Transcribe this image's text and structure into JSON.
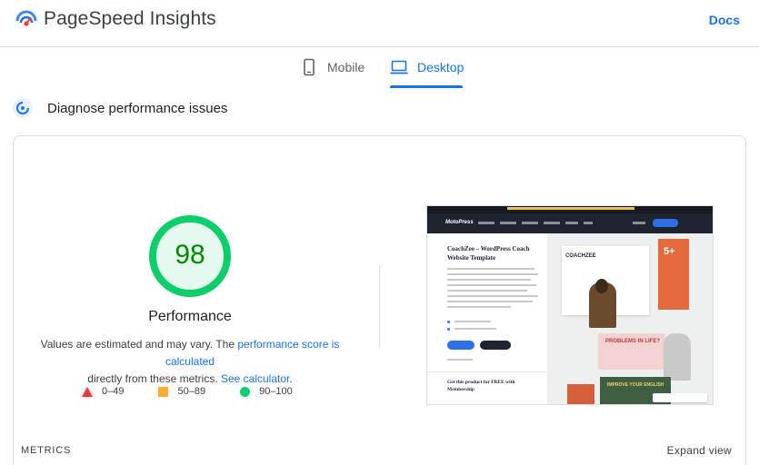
{
  "header": {
    "app_title": "PageSpeed Insights",
    "logo_icon": "pagespeed-logo-icon",
    "docs_label": "Docs"
  },
  "tabs": [
    {
      "label": "Mobile",
      "icon": "smartphone-icon",
      "selected": false
    },
    {
      "label": "Desktop",
      "icon": "laptop-icon",
      "selected": true
    }
  ],
  "diagnose": {
    "icon": "diagnose-icon",
    "title": "Diagnose performance issues"
  },
  "performance": {
    "score": "98",
    "label": "Performance",
    "note_prefix": "Values are estimated and may vary. The ",
    "note_link1": "performance score is calculated",
    "note_middle": " directly from these metrics. ",
    "note_link2": "See calculator",
    "note_suffix": "."
  },
  "legend": [
    {
      "label": "0–49",
      "icon": "fail-triangle-icon",
      "color": "#ff3333"
    },
    {
      "label": "50–89",
      "icon": "average-square-icon",
      "color": "#ffaa33"
    },
    {
      "label": "90–100",
      "icon": "pass-circle-icon",
      "color": "#0cce6b"
    }
  ],
  "screenshot": {
    "brand": "MotoPress",
    "title": "CoachZee – WordPress Coach Website Template",
    "subtitle": "Get this product for FREE with Membership",
    "logo_text": "COACHZEE",
    "panel_number": "5+",
    "panel_text": "PROBLEMS IN LIFE?",
    "panel_text2": "IMPROVE YOUR ENGLISH"
  },
  "metrics": {
    "section_label": "METRICS",
    "expand_label": "Expand view"
  },
  "colors": {
    "accent": "#1a73e8",
    "pass": "#0cce6b",
    "score_text": "#008800",
    "gauge_fill": "#e6f9ef"
  }
}
